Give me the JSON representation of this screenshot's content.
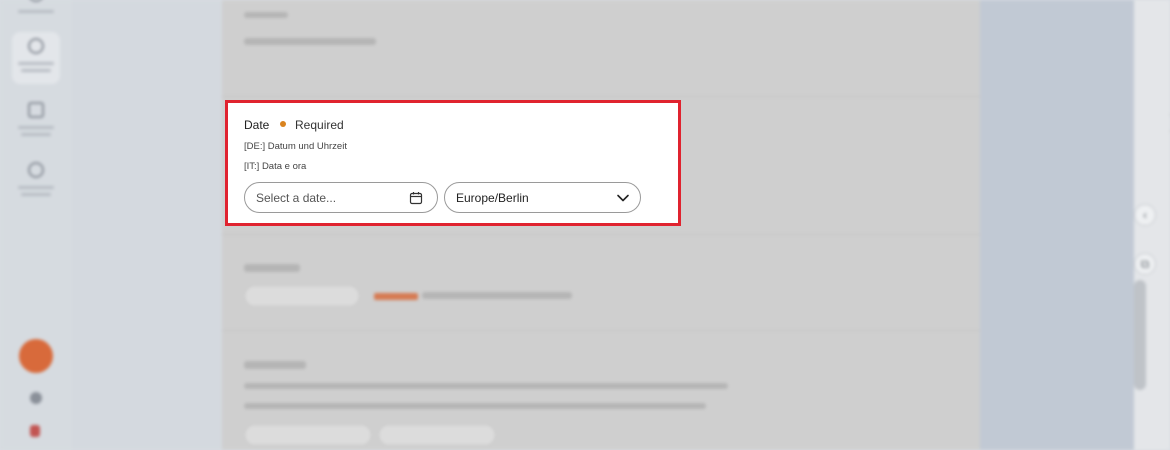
{
  "field": {
    "label": "Date",
    "required_label": "Required",
    "translations": {
      "de": "[DE:] Datum und Uhrzeit",
      "it": "[IT:] Data e ora"
    },
    "date_input": {
      "placeholder": "Select a date...",
      "value": ""
    },
    "timezone": {
      "selected": "Europe/Berlin"
    }
  },
  "icons": {
    "calendar": "calendar-icon",
    "chevron": "chevron-down-icon"
  },
  "colors": {
    "highlight_border": "#e0232f",
    "required_dot": "#d9831f",
    "accent": "#d86a3b"
  }
}
